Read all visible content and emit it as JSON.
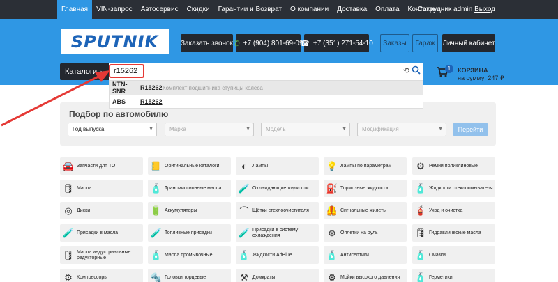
{
  "topnav": {
    "items": [
      "Главная",
      "VIN-запрос",
      "Автосервис",
      "Скидки",
      "Гарантии и Возврат",
      "О компании",
      "Доставка",
      "Оплата",
      "Контакты"
    ],
    "active_index": 0,
    "user_label": "Сотрудник admin",
    "logout_label": "Выход"
  },
  "header": {
    "logo_text": "SPUTNIK",
    "callback_label": "Заказать звонок",
    "phone1": "+7 (904) 801-69-09",
    "phone2": "+7 (351) 271-54-10",
    "orders_label": "Заказы",
    "garage_label": "Гараж",
    "cabinet_label": "Личный кабинет",
    "catalogs_label": "Каталоги",
    "search_value": "r15262",
    "cart_title": "КОРЗИНА",
    "cart_sum": "на сумму: 247 ₽",
    "cart_count": "1"
  },
  "dropdown": {
    "rows": [
      {
        "brand": "NTN-SNR",
        "code": "R15262",
        "desc": "Комплект подшипника ступицы колеса"
      },
      {
        "brand": "ABS",
        "code": "R15262",
        "desc": ""
      }
    ]
  },
  "selection": {
    "title": "Подбор по автомобилю",
    "year_placeholder": "Год выпуска",
    "make_placeholder": "Марка",
    "model_placeholder": "Модель",
    "mod_placeholder": "Модификация",
    "go_label": "Перейти"
  },
  "categories": [
    {
      "label": "Запчасти для ТО",
      "icon": "car-icon"
    },
    {
      "label": "Оригинальные каталоги",
      "icon": "book-icon"
    },
    {
      "label": "Лампы",
      "icon": "headlight-icon"
    },
    {
      "label": "Лампы по параметрам",
      "icon": "bulb-icon"
    },
    {
      "label": "Ремни поликлиновые",
      "icon": "belt-icon"
    },
    {
      "label": "Масла",
      "icon": "oil-can-icon"
    },
    {
      "label": "Трансмиссионные масла",
      "icon": "oil-bottle-icon"
    },
    {
      "label": "Охлаждающие жидкости",
      "icon": "coolant-icon"
    },
    {
      "label": "Тормозные жидкости",
      "icon": "brake-icon"
    },
    {
      "label": "Жидкости стеклоомывателя",
      "icon": "washer-icon"
    },
    {
      "label": "Диски",
      "icon": "wheel-icon"
    },
    {
      "label": "Аккумуляторы",
      "icon": "battery-icon"
    },
    {
      "label": "Щётки стеклоочистителя",
      "icon": "wiper-icon"
    },
    {
      "label": "Сигнальные жилеты",
      "icon": "vest-icon"
    },
    {
      "label": "Уход и очистка",
      "icon": "spray-icon"
    },
    {
      "label": "Присадки в масла",
      "icon": "additive-icon"
    },
    {
      "label": "Топливные присадки",
      "icon": "fuel-additive-icon"
    },
    {
      "label": "Присадки в систему охлаждения",
      "icon": "cooling-additive-icon"
    },
    {
      "label": "Оплетки на руль",
      "icon": "steering-wheel-icon"
    },
    {
      "label": "Гидравлические масла",
      "icon": "hydraulic-icon"
    },
    {
      "label": "Масла индустриальные редукторные",
      "icon": "industrial-oil-icon"
    },
    {
      "label": "Масла промывочные",
      "icon": "flush-oil-icon"
    },
    {
      "label": "Жидкости AdBlue",
      "icon": "adblue-icon"
    },
    {
      "label": "Антисептики",
      "icon": "antiseptic-icon"
    },
    {
      "label": "Смазки",
      "icon": "grease-icon"
    },
    {
      "label": "Компрессоры",
      "icon": "compressor-icon"
    },
    {
      "label": "Головки торцевые",
      "icon": "socket-icon"
    },
    {
      "label": "Домкраты",
      "icon": "jack-icon"
    },
    {
      "label": "Мойки высокого давления",
      "icon": "pressure-washer-icon"
    },
    {
      "label": "Герметики",
      "icon": "sealant-icon"
    }
  ],
  "colors": {
    "header_blue": "#2f97e4",
    "nav_dark": "#2b2f36",
    "highlight_red": "#e53935"
  }
}
